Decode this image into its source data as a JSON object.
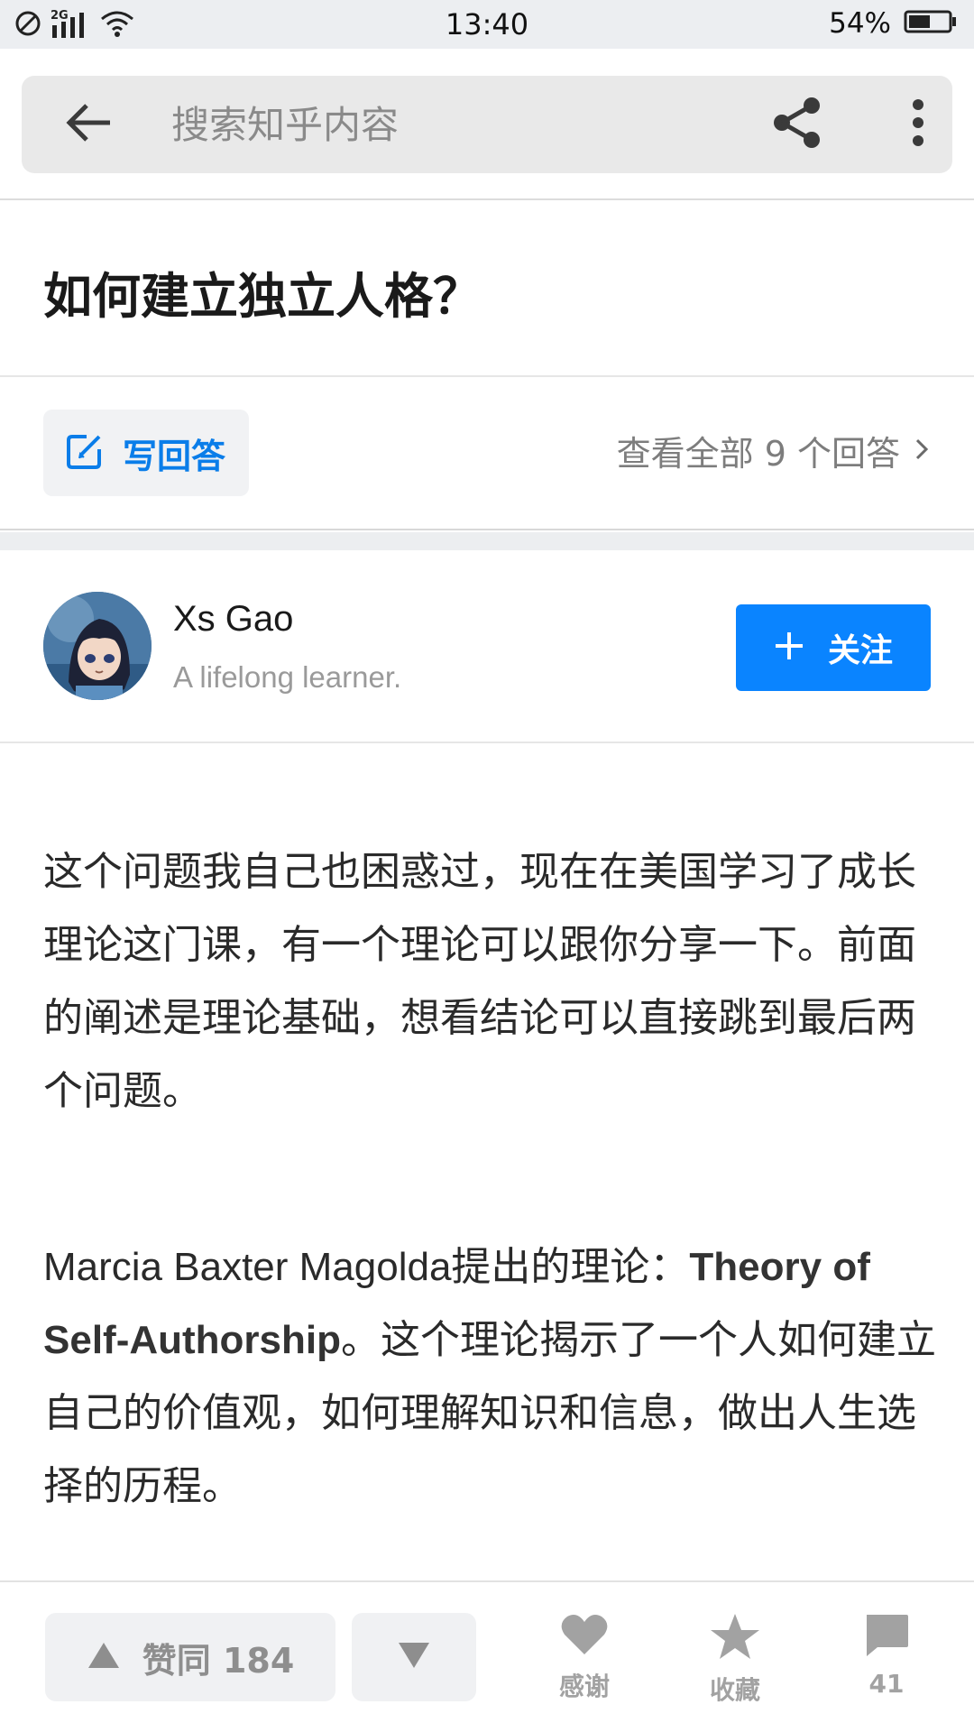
{
  "status_bar": {
    "network": "2G",
    "time": "13:40",
    "battery_percent": "54%",
    "battery_level": 0.54
  },
  "search": {
    "placeholder": "搜索知乎内容"
  },
  "question": {
    "title": "如何建立独立人格？"
  },
  "actions": {
    "write_answer": "写回答",
    "view_all": "查看全部 9 个回答"
  },
  "author": {
    "name": "Xs Gao",
    "bio": "A lifelong learner.",
    "follow_label": "关注"
  },
  "answer": {
    "paragraph_1": "这个问题我自己也困惑过，现在在美国学习了成长理论这门课，有一个理论可以跟你分享一下。前面的阐述是理论基础，想看结论可以直接跳到最后两个问题。",
    "paragraph_2_prefix": "Marcia Baxter Magolda提出的理论：",
    "paragraph_2_bold": "Theory of Self-Authorship",
    "paragraph_2_suffix": "。这个理论揭示了一个人如何建立自己的价值观，如何理解知识和信息，做出人生选择的历程。"
  },
  "bottom_bar": {
    "upvote_label": "赞同 184",
    "thanks_label": "感谢",
    "favorite_label": "收藏",
    "comment_count": "41"
  },
  "colors": {
    "accent": "#0a84ff",
    "link_blue": "#0a7de9",
    "icon_gray": "#9a9a9a"
  },
  "icons": [
    "no-sim-icon",
    "signal-icon",
    "wifi-icon",
    "battery-icon",
    "back-arrow-icon",
    "share-icon",
    "more-vertical-icon",
    "edit-icon",
    "chevron-right-icon",
    "plus-icon",
    "triangle-up-icon",
    "triangle-down-icon",
    "heart-icon",
    "star-icon",
    "comment-icon"
  ]
}
